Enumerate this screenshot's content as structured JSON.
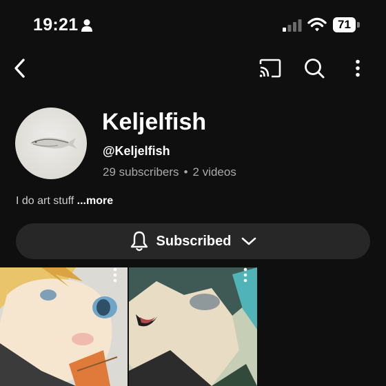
{
  "status_bar": {
    "time": "19:21",
    "battery": "71",
    "icons": [
      "person-icon",
      "signal-icon",
      "wifi-icon",
      "battery-icon"
    ]
  },
  "nav": {
    "icons": [
      "back-icon",
      "cast-icon",
      "search-icon",
      "more-vert-icon"
    ]
  },
  "channel": {
    "name": "Keljelfish",
    "handle": "@Keljelfish",
    "subscribers": "29 subscribers",
    "separator": "•",
    "videos": "2 videos",
    "description": "I do art stuff",
    "more_label": "...more"
  },
  "subscribe": {
    "label": "Subscribed",
    "icons": [
      "bell-icon",
      "chevron-down-icon"
    ]
  },
  "videos": [
    {
      "thumbnail_icon": "video-thumbnail",
      "menu_icon": "more-vert-icon"
    },
    {
      "thumbnail_icon": "video-thumbnail",
      "menu_icon": "more-vert-icon"
    }
  ],
  "colors": {
    "background": "#0f0f0f",
    "pill": "#272727",
    "text": "#ffffff",
    "secondary_text": "#aaaaaa"
  }
}
